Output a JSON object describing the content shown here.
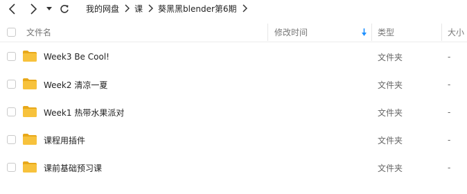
{
  "breadcrumb": [
    "我的网盘",
    "课",
    "葵黑黑blender第6期"
  ],
  "columns": {
    "name": "文件名",
    "modified": "修改时间",
    "type": "类型",
    "size": "大小"
  },
  "files": [
    {
      "name": "Week3 Be Cool!",
      "type": "文件夹",
      "size": "-"
    },
    {
      "name": "Week2 清凉一夏",
      "type": "文件夹",
      "size": "-"
    },
    {
      "name": "Week1 热带水果派对",
      "type": "文件夹",
      "size": "-"
    },
    {
      "name": "课程用插件",
      "type": "文件夹",
      "size": "-"
    },
    {
      "name": "课前基础预习课",
      "type": "文件夹",
      "size": "-"
    }
  ],
  "colors": {
    "folder": "#f7c23c",
    "folder_tab": "#e8a81a",
    "sort_arrow": "#1e90ff"
  }
}
